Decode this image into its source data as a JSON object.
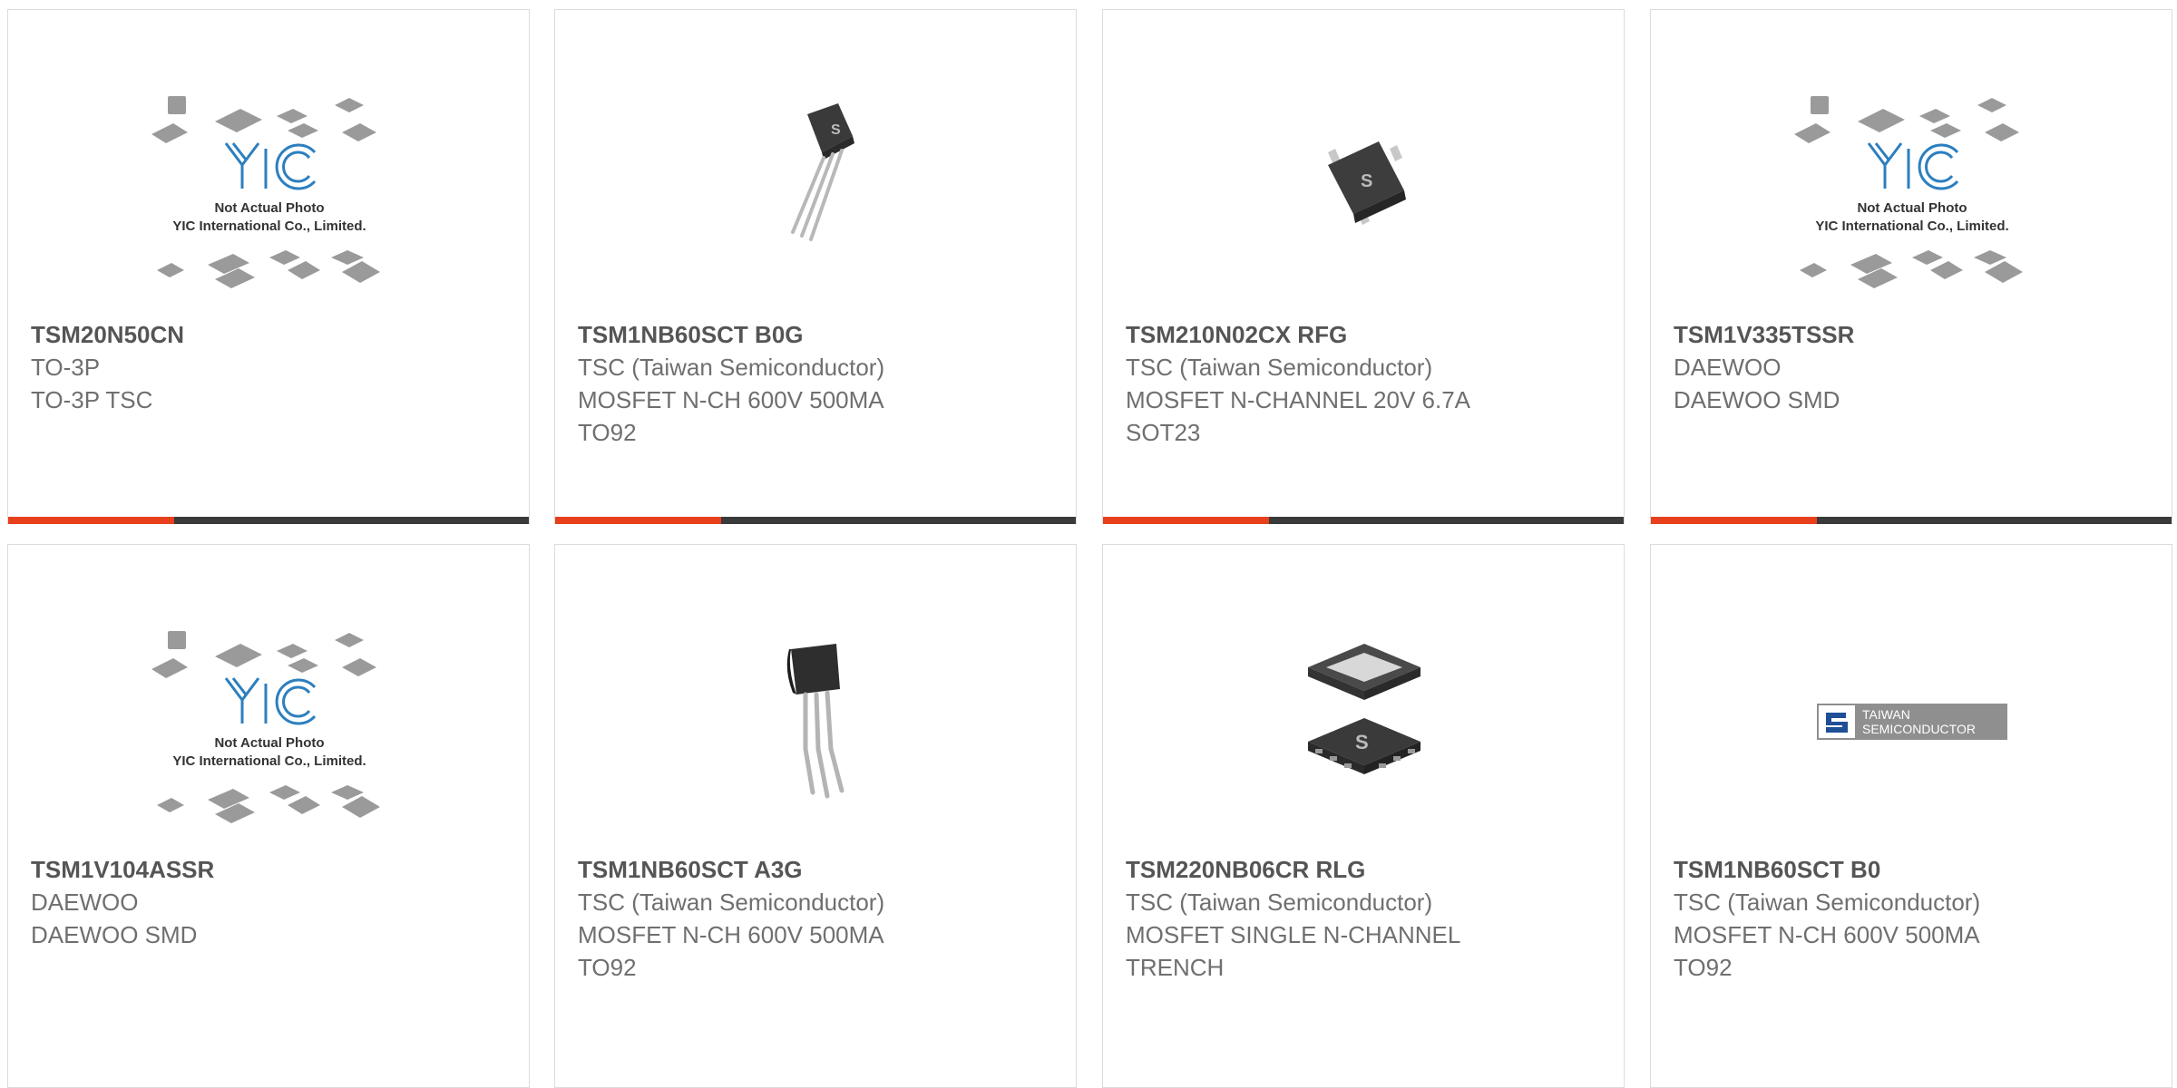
{
  "accent_color": "#e8401c",
  "bar_color": "#3a3a3a",
  "placeholder": {
    "line1": "Not Actual Photo",
    "line2": "YIC International Co., Limited."
  },
  "tsc_logo": {
    "line1": "TAIWAN",
    "line2": "SEMICONDUCTOR"
  },
  "products": [
    {
      "part": "TSM20N50CN",
      "lines": [
        "TO-3P",
        "TO-3P TSC",
        ""
      ],
      "image": "yic-placeholder-icon"
    },
    {
      "part": "TSM1NB60SCT B0G",
      "lines": [
        "TSC (Taiwan Semiconductor)",
        "MOSFET N-CH 600V 500MA",
        "TO92"
      ],
      "image": "to92-package-icon"
    },
    {
      "part": "TSM210N02CX RFG",
      "lines": [
        "TSC (Taiwan Semiconductor)",
        "MOSFET N-CHANNEL 20V 6.7A",
        "SOT23"
      ],
      "image": "sot23-package-icon"
    },
    {
      "part": "TSM1V335TSSR",
      "lines": [
        "DAEWOO",
        "DAEWOO SMD",
        ""
      ],
      "image": "yic-placeholder-icon"
    },
    {
      "part": "TSM1V104ASSR",
      "lines": [
        "DAEWOO",
        "DAEWOO SMD",
        ""
      ],
      "image": "yic-placeholder-icon"
    },
    {
      "part": "TSM1NB60SCT A3G",
      "lines": [
        "TSC (Taiwan Semiconductor)",
        "MOSFET N-CH 600V 500MA",
        "TO92"
      ],
      "image": "to92-package-icon"
    },
    {
      "part": "TSM220NB06CR RLG",
      "lines": [
        "TSC (Taiwan Semiconductor)",
        "MOSFET SINGLE N-CHANNEL",
        "TRENCH"
      ],
      "image": "dfn-package-icon"
    },
    {
      "part": "TSM1NB60SCT B0",
      "lines": [
        "TSC (Taiwan Semiconductor)",
        "MOSFET N-CH 600V 500MA",
        "TO92"
      ],
      "image": "tsc-logo-icon"
    }
  ]
}
